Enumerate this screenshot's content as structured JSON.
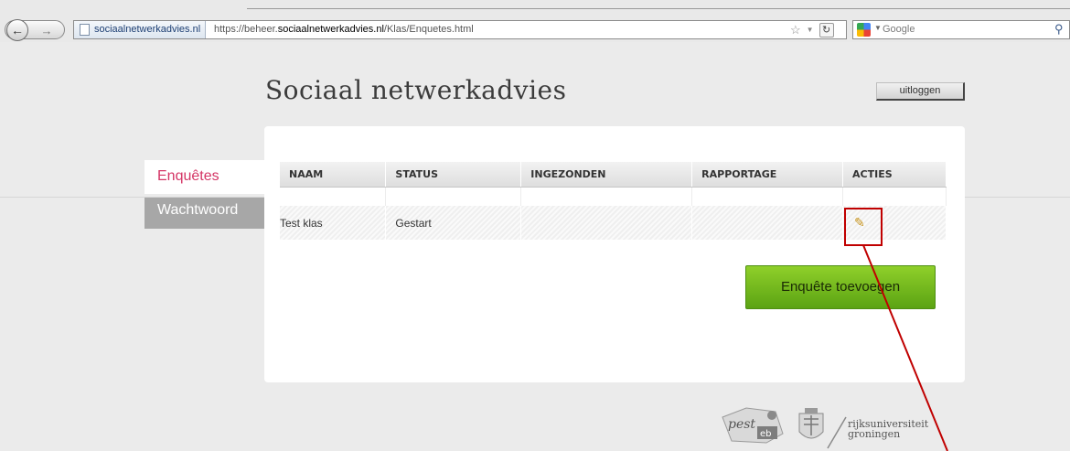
{
  "browser": {
    "site_identity": "sociaalnetwerkadvies.nl",
    "url_prefix": "https://beheer.",
    "url_domain": "sociaalnetwerkadvies.nl",
    "url_path": "/Klas/Enquetes.html",
    "search_engine": "Google",
    "icons": {
      "back": "back-arrow-icon",
      "forward": "forward-arrow-icon",
      "reload": "reload-icon",
      "bookmark": "star-icon",
      "search": "magnifier-icon"
    }
  },
  "header": {
    "title": "Sociaal netwerkadvies",
    "logout_label": "uitloggen"
  },
  "sidebar": {
    "items": [
      {
        "label": "Enquêtes",
        "active": true
      },
      {
        "label": "Wachtwoord",
        "active": false
      }
    ]
  },
  "table": {
    "columns": [
      "NAAM",
      "STATUS",
      "INGEZONDEN",
      "RAPPORTAGE",
      "ACTIES"
    ],
    "rows": [
      {
        "naam": "Test klas",
        "status": "Gestart",
        "ingezonden": "",
        "rapportage": "",
        "acties_icon": "edit-pencil-icon"
      }
    ]
  },
  "main": {
    "add_button_label": "Enquête toevoegen"
  },
  "footer": {
    "logos": [
      "pestweb-logo",
      "rijksuniversiteit-groningen-logo"
    ],
    "rug_text_line1": "rijksuniversiteit",
    "rug_text_line2": "groningen"
  },
  "colors": {
    "active_tab_text": "#d43565",
    "inactive_tab_bg": "#a7a7a7",
    "add_button": "#6db81b",
    "annotation": "#c00000"
  }
}
